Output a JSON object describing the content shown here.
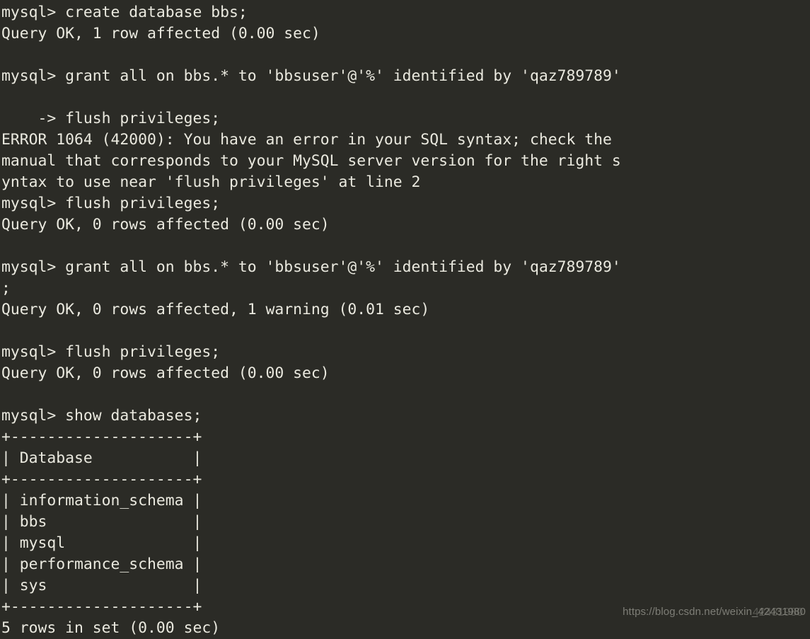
{
  "terminal": {
    "background_color": "#2b2b26",
    "text_color": "#eae9df",
    "prompt": "mysql>",
    "continuation_prompt": "->",
    "lines": [
      "mysql> create database bbs;",
      "Query OK, 1 row affected (0.00 sec)",
      "",
      "mysql> grant all on bbs.* to 'bbsuser'@'%' identified by 'qaz789789'",
      "",
      "    -> flush privileges;",
      "ERROR 1064 (42000): You have an error in your SQL syntax; check the",
      "manual that corresponds to your MySQL server version for the right s",
      "yntax to use near 'flush privileges' at line 2",
      "mysql> flush privileges;",
      "Query OK, 0 rows affected (0.00 sec)",
      "",
      "mysql> grant all on bbs.* to 'bbsuser'@'%' identified by 'qaz789789'",
      ";",
      "Query OK, 0 rows affected, 1 warning (0.01 sec)",
      "",
      "mysql> flush privileges;",
      "Query OK, 0 rows affected (0.00 sec)",
      "",
      "mysql> show databases;",
      "+--------------------+",
      "| Database           |",
      "+--------------------+",
      "| information_schema |",
      "| bbs                |",
      "| mysql              |",
      "| performance_schema |",
      "| sys                |",
      "+--------------------+",
      "5 rows in set (0.00 sec)"
    ],
    "commands": [
      "create database bbs;",
      "grant all on bbs.* to 'bbsuser'@'%' identified by 'qaz789789'",
      "flush privileges;",
      "flush privileges;",
      "grant all on bbs.* to 'bbsuser'@'%' identified by 'qaz789789';",
      "flush privileges;",
      "show databases;"
    ],
    "results": {
      "create_database": "Query OK, 1 row affected (0.00 sec)",
      "error_code": "ERROR 1064 (42000)",
      "error_message": "ERROR 1064 (42000): You have an error in your SQL syntax; check the manual that corresponds to your MySQL server version for the right syntax to use near 'flush privileges' at line 2",
      "flush_privileges_1": "Query OK, 0 rows affected (0.00 sec)",
      "grant_warning": "Query OK, 0 rows affected, 1 warning (0.01 sec)",
      "flush_privileges_2": "Query OK, 0 rows affected (0.00 sec)",
      "row_count": "5 rows in set (0.00 sec)"
    },
    "databases_table": {
      "column_header": "Database",
      "border": "+--------------------+",
      "rows": [
        "information_schema",
        "bbs",
        "mysql",
        "performance_schema",
        "sys"
      ]
    }
  },
  "watermark": {
    "text": "https://blog.csdn.net/weixin_42431980",
    "overlay_text": "42431980",
    "color": "#8c8c84"
  }
}
